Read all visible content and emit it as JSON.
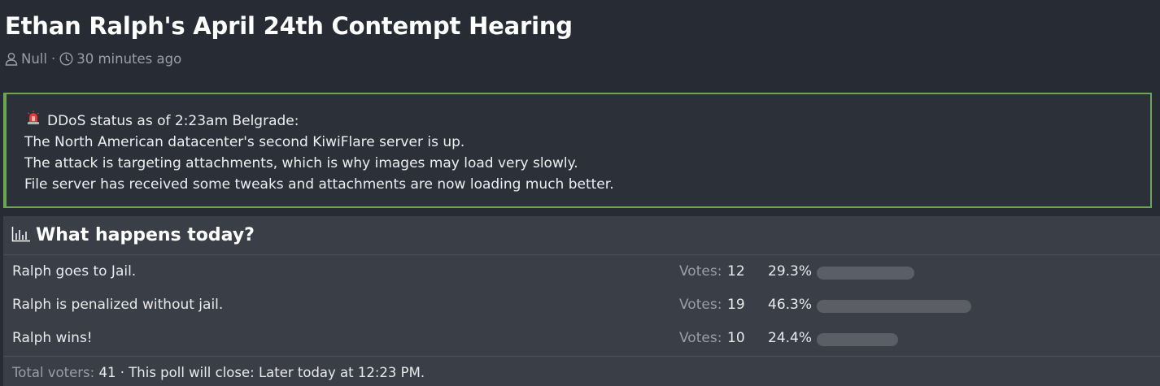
{
  "thread": {
    "title": "Ethan Ralph's April 24th Contempt Hearing",
    "author": "Null",
    "separator": "·",
    "time": "30 minutes ago"
  },
  "notice": {
    "lines": [
      "DDoS status as of 2:23am Belgrade:",
      "The North American datacenter's second KiwiFlare server is up.",
      "The attack is targeting attachments, which is why images may load very slowly.",
      "File server has received some tweaks and attachments are now loading much better."
    ],
    "border_color": "#6aa84f"
  },
  "poll": {
    "title": "What happens today?",
    "votes_label": "Votes:",
    "options": [
      {
        "label": "Ralph goes to Jail.",
        "votes": "12",
        "percent": "29.3%",
        "fraction": 0.293
      },
      {
        "label": "Ralph is penalized without jail.",
        "votes": "19",
        "percent": "46.3%",
        "fraction": 0.463
      },
      {
        "label": "Ralph wins!",
        "votes": "10",
        "percent": "24.4%",
        "fraction": 0.244
      }
    ],
    "footer": {
      "total_label": "Total voters:",
      "total": "41",
      "sep": "·",
      "close_text": "This poll will close: Later today at 12:23 PM."
    }
  }
}
